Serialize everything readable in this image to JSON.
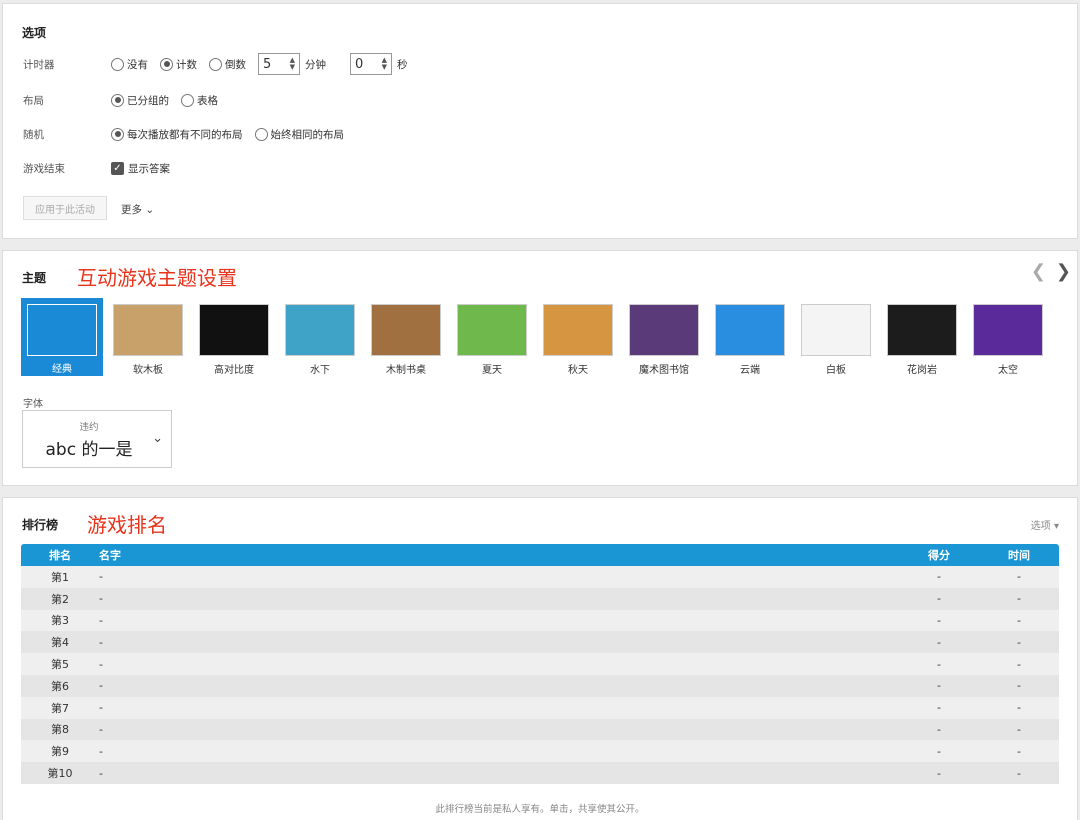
{
  "options": {
    "title": "选项",
    "timer": {
      "label": "计时器",
      "opts": [
        "没有",
        "计数",
        "倒数"
      ],
      "selected": 1,
      "minutes": "5",
      "minutes_unit": "分钟",
      "seconds": "0",
      "seconds_unit": "秒"
    },
    "layout": {
      "label": "布局",
      "opts": [
        "已分组的",
        "表格"
      ],
      "selected": 0
    },
    "random": {
      "label": "随机",
      "opts": [
        "每次播放都有不同的布局",
        "始终相同的布局"
      ],
      "selected": 0
    },
    "game_end": {
      "label": "游戏结束",
      "check_label": "显示答案",
      "checked": true
    },
    "apply_label": "应用于此活动",
    "more_label": "更多"
  },
  "theme": {
    "title": "主题",
    "annotation": "互动游戏主题设置",
    "tiles": [
      {
        "label": "经典",
        "icon": "classic-theme-icon",
        "bg": "#1a8ad6"
      },
      {
        "label": "软木板",
        "icon": "corkboard-theme-icon",
        "bg": "#c8a06a"
      },
      {
        "label": "高对比度",
        "icon": "high-contrast-theme-icon",
        "bg": "#111111"
      },
      {
        "label": "水下",
        "icon": "underwater-theme-icon",
        "bg": "#3fa3c8"
      },
      {
        "label": "木制书桌",
        "icon": "wooden-desk-theme-icon",
        "bg": "#a07040"
      },
      {
        "label": "夏天",
        "icon": "summer-theme-icon",
        "bg": "#6fb84c"
      },
      {
        "label": "秋天",
        "icon": "autumn-theme-icon",
        "bg": "#d69540"
      },
      {
        "label": "魔术图书馆",
        "icon": "magic-library-theme-icon",
        "bg": "#5a3a78"
      },
      {
        "label": "云端",
        "icon": "cloud-theme-icon",
        "bg": "#2a8ee0"
      },
      {
        "label": "白板",
        "icon": "whiteboard-theme-icon",
        "bg": "#f4f4f4"
      },
      {
        "label": "花岗岩",
        "icon": "granite-theme-icon",
        "bg": "#1c1c1c"
      },
      {
        "label": "太空",
        "icon": "space-theme-icon",
        "bg": "#5a2a9a"
      }
    ],
    "font_label": "字体",
    "font_name": "违约",
    "font_sample": "abc 的一是"
  },
  "leaderboard": {
    "title": "排行榜",
    "annotation": "游戏排名",
    "options_label": "选项",
    "headers": {
      "rank": "排名",
      "name": "名字",
      "score": "得分",
      "time": "时间"
    },
    "rows": [
      {
        "rank": "第1",
        "name": "-",
        "score": "-",
        "time": "-"
      },
      {
        "rank": "第2",
        "name": "-",
        "score": "-",
        "time": "-"
      },
      {
        "rank": "第3",
        "name": "-",
        "score": "-",
        "time": "-"
      },
      {
        "rank": "第4",
        "name": "-",
        "score": "-",
        "time": "-"
      },
      {
        "rank": "第5",
        "name": "-",
        "score": "-",
        "time": "-"
      },
      {
        "rank": "第6",
        "name": "-",
        "score": "-",
        "time": "-"
      },
      {
        "rank": "第7",
        "name": "-",
        "score": "-",
        "time": "-"
      },
      {
        "rank": "第8",
        "name": "-",
        "score": "-",
        "time": "-"
      },
      {
        "rank": "第9",
        "name": "-",
        "score": "-",
        "time": "-"
      },
      {
        "rank": "第10",
        "name": "-",
        "score": "-",
        "time": "-"
      }
    ],
    "footnote": "此排行榜当前是私人享有。单击，共享使其公开。"
  }
}
